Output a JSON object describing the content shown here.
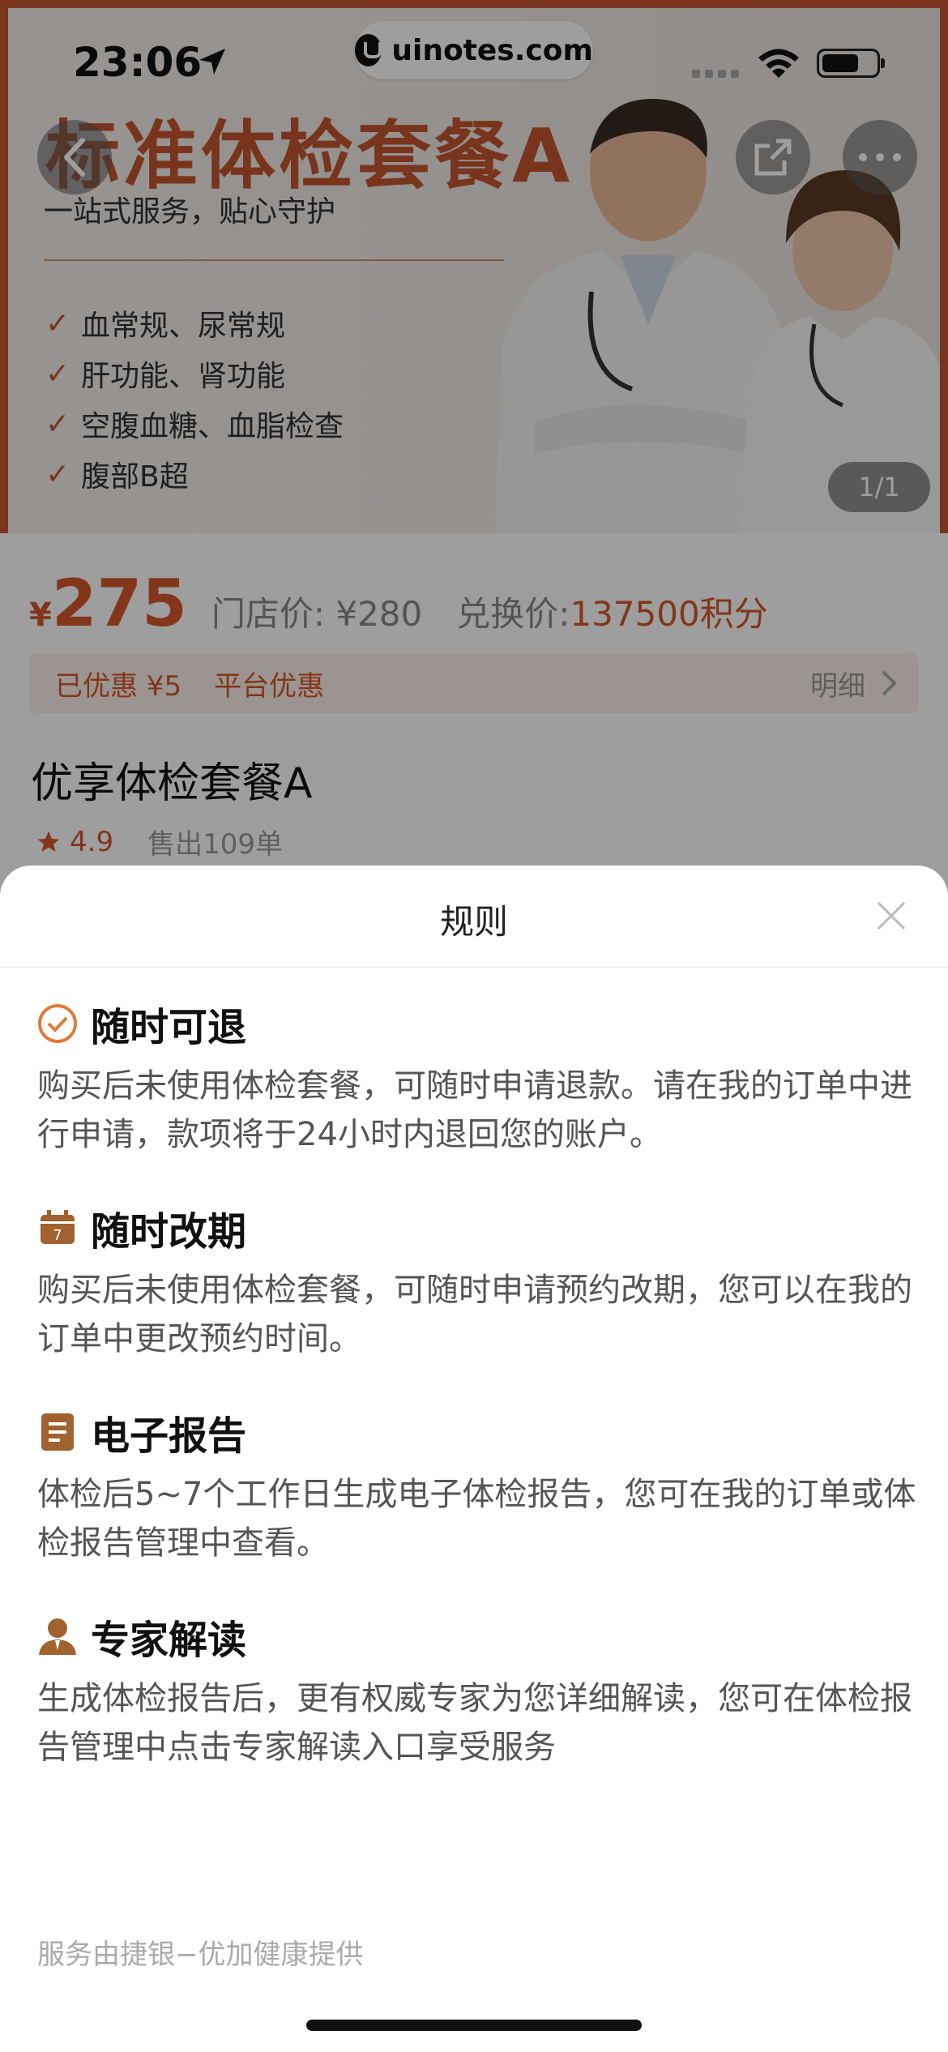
{
  "status_bar": {
    "time": "23:06",
    "site": "uinotes.com"
  },
  "hero": {
    "title": "标准体检套餐A",
    "subtitle": "一站式服务，贴心守护",
    "items": [
      "血常规、尿常规",
      "肝功能、肾功能",
      "空腹血糖、血脂检查",
      "腹部B超"
    ],
    "check_glyph": "✓",
    "page_indicator": "1/1"
  },
  "product": {
    "currency": "¥",
    "price": "275",
    "store_price": "门店价: ¥280",
    "exchange_label": "兑换价:",
    "exchange_value": "137500积分",
    "promo_discount": "已优惠 ¥5",
    "promo_platform": "平台优惠",
    "promo_detail": "明细",
    "title": "优享体检套餐A",
    "rating": "4.9",
    "sold": "售出109单"
  },
  "sheet": {
    "title": "规则",
    "sections": [
      {
        "icon": "check-circle-icon",
        "title": "随时可退",
        "body": "购买后未使用体检套餐，可随时申请退款。请在我的订单中进行申请，款项将于24小时内退回您的账户。"
      },
      {
        "icon": "calendar-icon",
        "title": "随时改期",
        "body": "购买后未使用体检套餐，可随时申请预约改期，您可以在我的订单中更改预约时间。"
      },
      {
        "icon": "document-icon",
        "title": "电子报告",
        "body": "体检后5~7个工作日生成电子体检报告，您可在我的订单或体检报告管理中查看。"
      },
      {
        "icon": "expert-icon",
        "title": "专家解读",
        "body": "生成体检报告后，更有权威专家为您详细解读，您可在体检报告管理中点击专家解读入口享受服务"
      }
    ],
    "footer": "服务由捷银−优加健康提供"
  },
  "colors": {
    "accent": "#d4572a",
    "banner_red": "#c2552e",
    "icon_brown": "#a0622e"
  }
}
